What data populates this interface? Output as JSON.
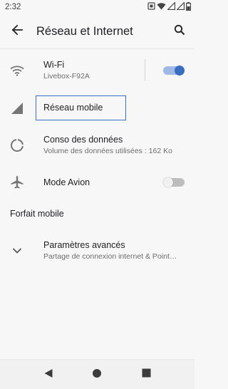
{
  "status_bar": {
    "time": "2:32",
    "icons": [
      "sim-card-icon",
      "wifi-icon",
      "signal-icon",
      "signal-icon",
      "battery-icon"
    ]
  },
  "app_bar": {
    "title": "Réseau et Internet",
    "back_icon": "arrow-back-icon",
    "search_icon": "search-icon"
  },
  "items": [
    {
      "icon": "wifi-icon",
      "title": "Wi-Fi",
      "subtitle": "Livebox-F92A",
      "toggle": true
    },
    {
      "icon": "signal-icon",
      "title": "Réseau mobile",
      "focused": true
    },
    {
      "icon": "data-usage-icon",
      "title": "Conso des données",
      "subtitle": "Volume des données utilisées : 162 Ko"
    },
    {
      "icon": "airplane-icon",
      "title": "Mode Avion",
      "toggle": false
    }
  ],
  "section": {
    "header": "Forfait mobile"
  },
  "advanced": {
    "icon": "chevron-down-icon",
    "title": "Paramètres avancés",
    "subtitle": "Partage de connexion internet & Point…"
  },
  "nav_bar": {
    "icons": [
      "nav-back-icon",
      "home-icon",
      "recents-icon"
    ]
  },
  "colors": {
    "accent": "#3a6ec2",
    "toggle_on_track": "#9fb8e8",
    "toggle_on_knob": "#3a6ec2",
    "toggle_off_track": "#bdbdbd",
    "toggle_off_knob": "#f1f1f1"
  }
}
